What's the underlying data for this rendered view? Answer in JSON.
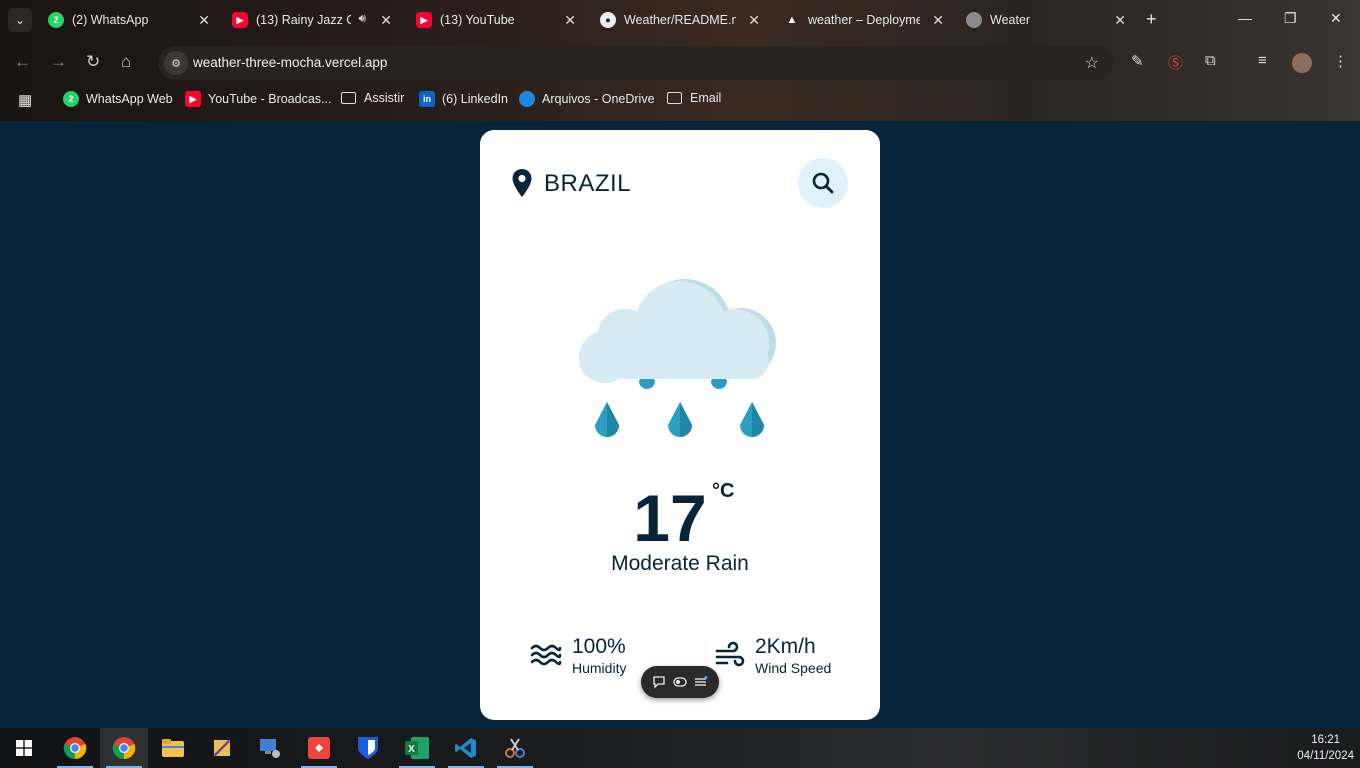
{
  "browser": {
    "tabs": [
      {
        "title": "(2) WhatsApp",
        "favicon": "whatsapp-icon",
        "badge": "2"
      },
      {
        "title": "(13) Rainy Jazz Ca",
        "favicon": "youtube-icon",
        "audio": true
      },
      {
        "title": "(13) YouTube",
        "favicon": "youtube-icon"
      },
      {
        "title": "Weather/README.m",
        "favicon": "github-icon"
      },
      {
        "title": "weather – Deployme",
        "favicon": "vercel-icon"
      },
      {
        "title": "Weater",
        "favicon": "globe-icon",
        "active": true
      }
    ],
    "url": "weather-three-mocha.vercel.app",
    "bookmarks": [
      {
        "label": "WhatsApp Web",
        "icon": "whatsapp-icon"
      },
      {
        "label": "YouTube - Broadcas...",
        "icon": "youtube-icon"
      },
      {
        "label": "Assistir",
        "icon": "folder-icon"
      },
      {
        "label": "(6) LinkedIn",
        "icon": "linkedin-icon"
      },
      {
        "label": "Arquivos - OneDrive",
        "icon": "onedrive-icon"
      },
      {
        "label": "Email",
        "icon": "folder-icon"
      }
    ]
  },
  "weather": {
    "location": "BRAZIL",
    "temperature": "17",
    "unit": "°C",
    "description": "Moderate Rain",
    "humidity": {
      "value": "100%",
      "label": "Humidity"
    },
    "wind": {
      "value": "2Km/h",
      "label": "Wind Speed"
    }
  },
  "taskbar": {
    "time": "16:21",
    "date": "04/11/2024"
  },
  "colors": {
    "page_bg": "#06243a",
    "card_bg": "#ffffff",
    "search_bg": "#dff2fa",
    "text_dark": "#06243a",
    "cloud": "#d6ebf3",
    "drop": "#2a9fc0"
  }
}
